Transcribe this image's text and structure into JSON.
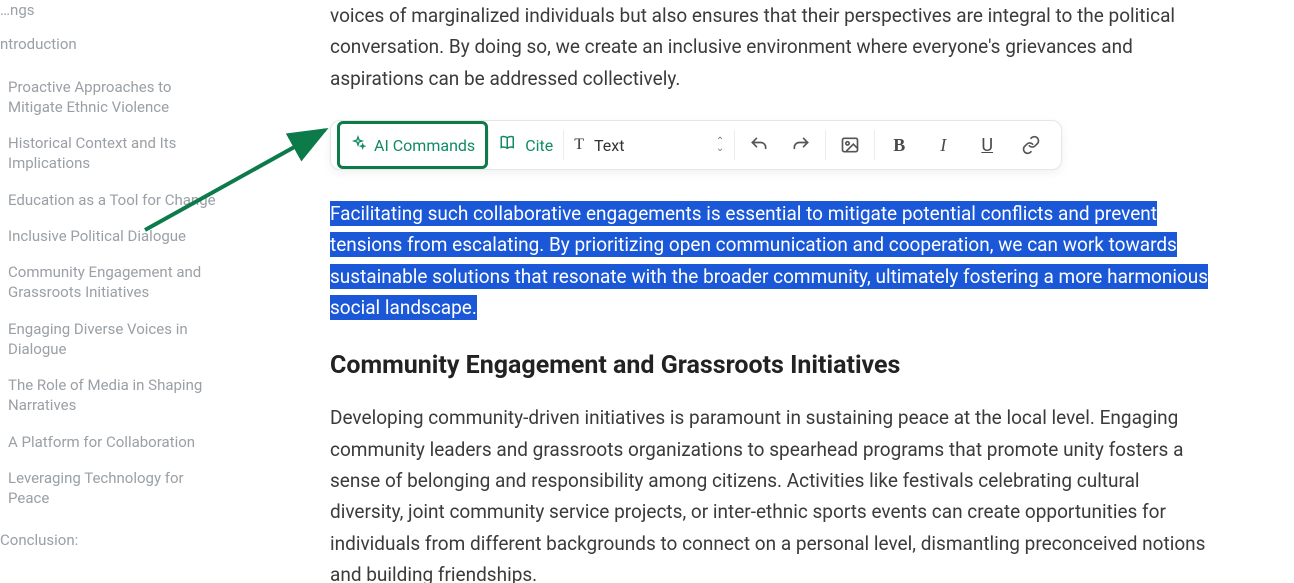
{
  "sidebar": {
    "partial_top": "…ngs",
    "section_label": "ntroduction",
    "items": [
      "Proactive Approaches to Mitigate Ethnic Violence",
      "Historical Context and Its Implications",
      "Education as a Tool for Change",
      "Inclusive Political Dialogue",
      "Community Engagement and Grassroots Initiatives",
      "Engaging Diverse Voices in Dialogue",
      "The Role of Media in Shaping Narratives",
      "A Platform for Collaboration",
      "Leveraging Technology for Peace"
    ],
    "footer_label": "Conclusion:"
  },
  "toolbar": {
    "ai_commands_label": "AI Commands",
    "cite_label": "Cite",
    "text_dropdown_label": "Text",
    "type_icon_letter": "T",
    "bold_letter": "B",
    "italic_letter": "I",
    "underline_letter": "U"
  },
  "content": {
    "intro_paragraph_partial": "voices of marginalized individuals but also ensures that their perspectives are integral to the political conversation. By doing so, we create an inclusive environment where everyone's grievances and aspirations can be addressed collectively.",
    "selected_paragraph": "Facilitating such collaborative engagements is essential to mitigate potential conflicts and prevent tensions from escalating. By prioritizing open communication and cooperation, we can work towards sustainable solutions that resonate with the broader community, ultimately fostering a more harmonious social landscape.",
    "heading2": "Community Engagement and Grassroots Initiatives",
    "body_paragraph": "Developing community-driven initiatives is paramount in sustaining peace at the local level. Engaging community leaders and grassroots organizations to spearhead programs that promote unity fosters a sense of belonging and responsibility among citizens. Activities like festivals celebrating cultural diversity, joint community service projects, or inter-ethnic sports events can create opportunities for individuals from different backgrounds to connect on a personal level, dismantling preconceived notions and building friendships."
  },
  "colors": {
    "accent_green": "#118a67",
    "highlight_box": "#0d7a4a",
    "selection_blue": "#1a58d8"
  }
}
